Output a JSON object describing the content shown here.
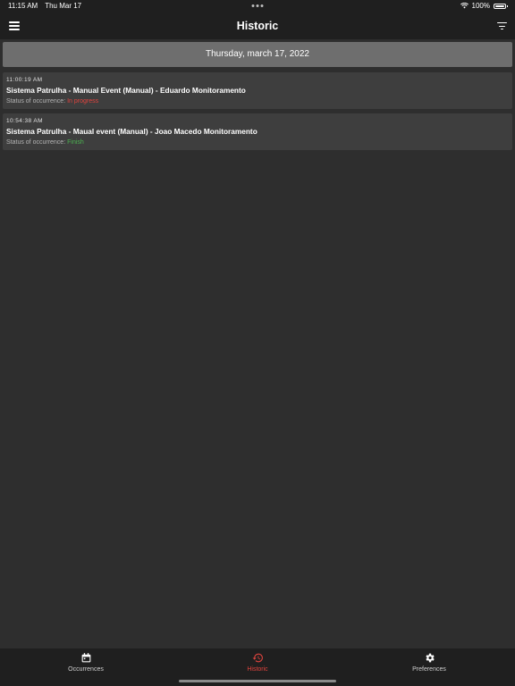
{
  "status_bar": {
    "time": "11:15 AM",
    "date": "Thu Mar 17",
    "battery": "100%"
  },
  "header": {
    "title": "Historic"
  },
  "date_banner": "Thursday, march 17, 2022",
  "occurrences": [
    {
      "time": "11:00:19 AM",
      "title": "Sistema Patrulha - Manual Event (Manual) - Eduardo Monitoramento",
      "status_label": "Status of occurrence:",
      "status_value": "In progress",
      "status_color": "#e0443e"
    },
    {
      "time": "10:54:38 AM",
      "title": "Sistema Patrulha - Maual event (Manual) - Joao Macedo Monitoramento",
      "status_label": "Status of occurrence:",
      "status_value": "Finish",
      "status_color": "#4caf50"
    }
  ],
  "tabs": [
    {
      "label": "Occurrences",
      "icon": "calendar-icon",
      "active": false
    },
    {
      "label": "Historic",
      "icon": "history-icon",
      "active": true
    },
    {
      "label": "Preferences",
      "icon": "gear-icon",
      "active": false
    }
  ],
  "colors": {
    "background": "#2e2e2e",
    "bar": "#1f1f1f",
    "card": "#3e3e3e",
    "banner": "#6e6e6e",
    "accent": "#e0443e",
    "success": "#4caf50"
  }
}
